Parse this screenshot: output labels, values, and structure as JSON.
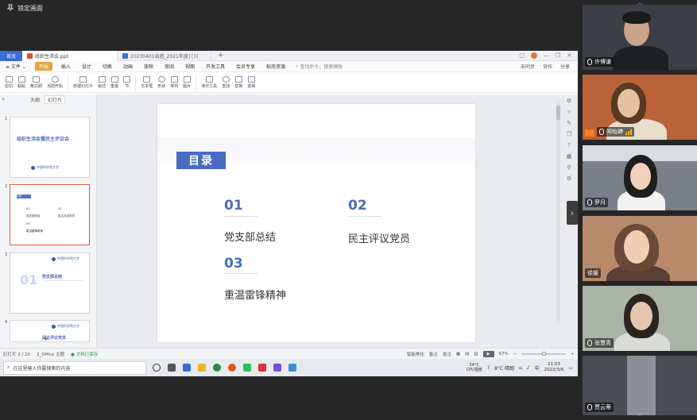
{
  "pin_label": "锁定画面",
  "app": {
    "home_tab": "首页",
    "tabs": [
      {
        "label": "组织生活会.ppt",
        "active": true
      },
      {
        "label": "20230401出团_2021年度]  [3]",
        "active": false
      }
    ],
    "tab_add": "+"
  },
  "menu": {
    "file": "≡ 文件 ⌄",
    "items": [
      "开始",
      "插入",
      "设计",
      "切换",
      "动画",
      "放映",
      "审阅",
      "视图",
      "开发工具",
      "会员专享",
      "稻壳资源"
    ],
    "search_placeholder": "查找命令、搜索模板",
    "right": [
      "未同步",
      "协作",
      "分享"
    ]
  },
  "ribbon": {
    "groups": [
      "剪切",
      "粘贴",
      "格式刷",
      "当前开始",
      "新建幻灯片",
      "版式",
      "重置",
      "节",
      "文本框",
      "形状",
      "排列",
      "图片",
      "演示工具",
      "查找",
      "替换",
      "选择"
    ]
  },
  "left_panel": {
    "tabs": [
      "大纲",
      "幻灯片"
    ],
    "collapse_icon": "«",
    "thumbs": [
      {
        "num": "1",
        "title": "组织生活会暨民主评议会",
        "logo": "中国科学院大学"
      },
      {
        "num": "2",
        "label": "目录",
        "items": [
          "01",
          "02",
          "党支部总结",
          "民主评议党员",
          "03",
          "重温雷锋精神"
        ]
      },
      {
        "num": "3",
        "big": "01",
        "sub": "党支部总结",
        "logo": "中国科学院大学"
      },
      {
        "num": "4",
        "logo": "中国科学院大学",
        "sub": "民主评议党员"
      }
    ],
    "add": "+"
  },
  "slide": {
    "tag": "目录",
    "sections": [
      {
        "num": "01",
        "text": "党支部总结"
      },
      {
        "num": "02",
        "text": "民主评议党员"
      },
      {
        "num": "03",
        "text": "重温雷锋精神"
      }
    ]
  },
  "status": {
    "page": "幻灯片 2 / 20",
    "theme": "2_Office 主题",
    "backup": "文档已保存",
    "beautify": "智能美化",
    "notes": "备注",
    "comments": "批注",
    "zoom": "67%"
  },
  "taskbar": {
    "search_placeholder": "在这里输入你要搜索的内容",
    "weather_temp": "54°C",
    "weather_label": "CPU温度",
    "temp": "8°C 晴朗",
    "ime": "中",
    "time": "21:03",
    "date": "2022/3/6"
  },
  "participants": [
    {
      "name": "许博谦",
      "mic": "normal"
    },
    {
      "name": "郑怡婷",
      "mic": "speaking"
    },
    {
      "name": "罗月",
      "mic": "normal"
    },
    {
      "name": "徐媛",
      "mic": "none"
    },
    {
      "name": "张慧青",
      "mic": "normal"
    },
    {
      "name": "贾云蒂",
      "mic": "normal"
    }
  ],
  "colors": {
    "accent": "#4a6cc0",
    "wps_orange": "#e8a33c",
    "brand_blue": "#3a6fd8"
  }
}
